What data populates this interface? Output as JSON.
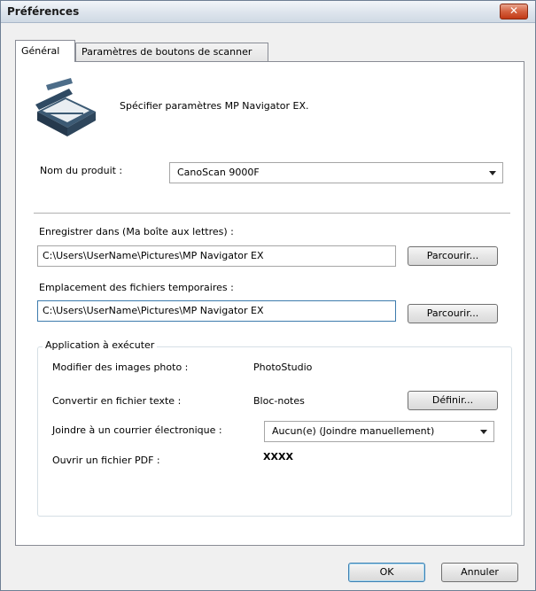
{
  "window": {
    "title": "Préférences",
    "close_label": "✕"
  },
  "tabs": [
    {
      "label": "Général"
    },
    {
      "label": "Paramètres de boutons de scanner"
    }
  ],
  "general": {
    "header_text": "Spécifier paramètres MP Navigator EX.",
    "product_label": "Nom du produit :",
    "product_value": "CanoScan 9000F",
    "save_in_label": "Enregistrer dans (Ma boîte aux lettres) :",
    "save_in_value": "C:\\Users\\UserName\\Pictures\\MP Navigator EX",
    "temp_label": "Emplacement des fichiers temporaires :",
    "temp_value": "C:\\Users\\UserName\\Pictures\\MP Navigator EX",
    "browse_label": "Parcourir...",
    "app_group_label": "Application à exécuter",
    "apps": {
      "edit_photo_label": "Modifier des images photo :",
      "edit_photo_value": "PhotoStudio",
      "text_label": "Convertir en fichier texte :",
      "text_value": "Bloc-notes",
      "define_label": "Définir...",
      "email_label": "Joindre à un courrier électronique :",
      "email_value": "Aucun(e) (Joindre manuellement)",
      "pdf_label": "Ouvrir un fichier PDF :",
      "pdf_value": "XXXX"
    }
  },
  "footer": {
    "ok_label": "OK",
    "cancel_label": "Annuler"
  }
}
